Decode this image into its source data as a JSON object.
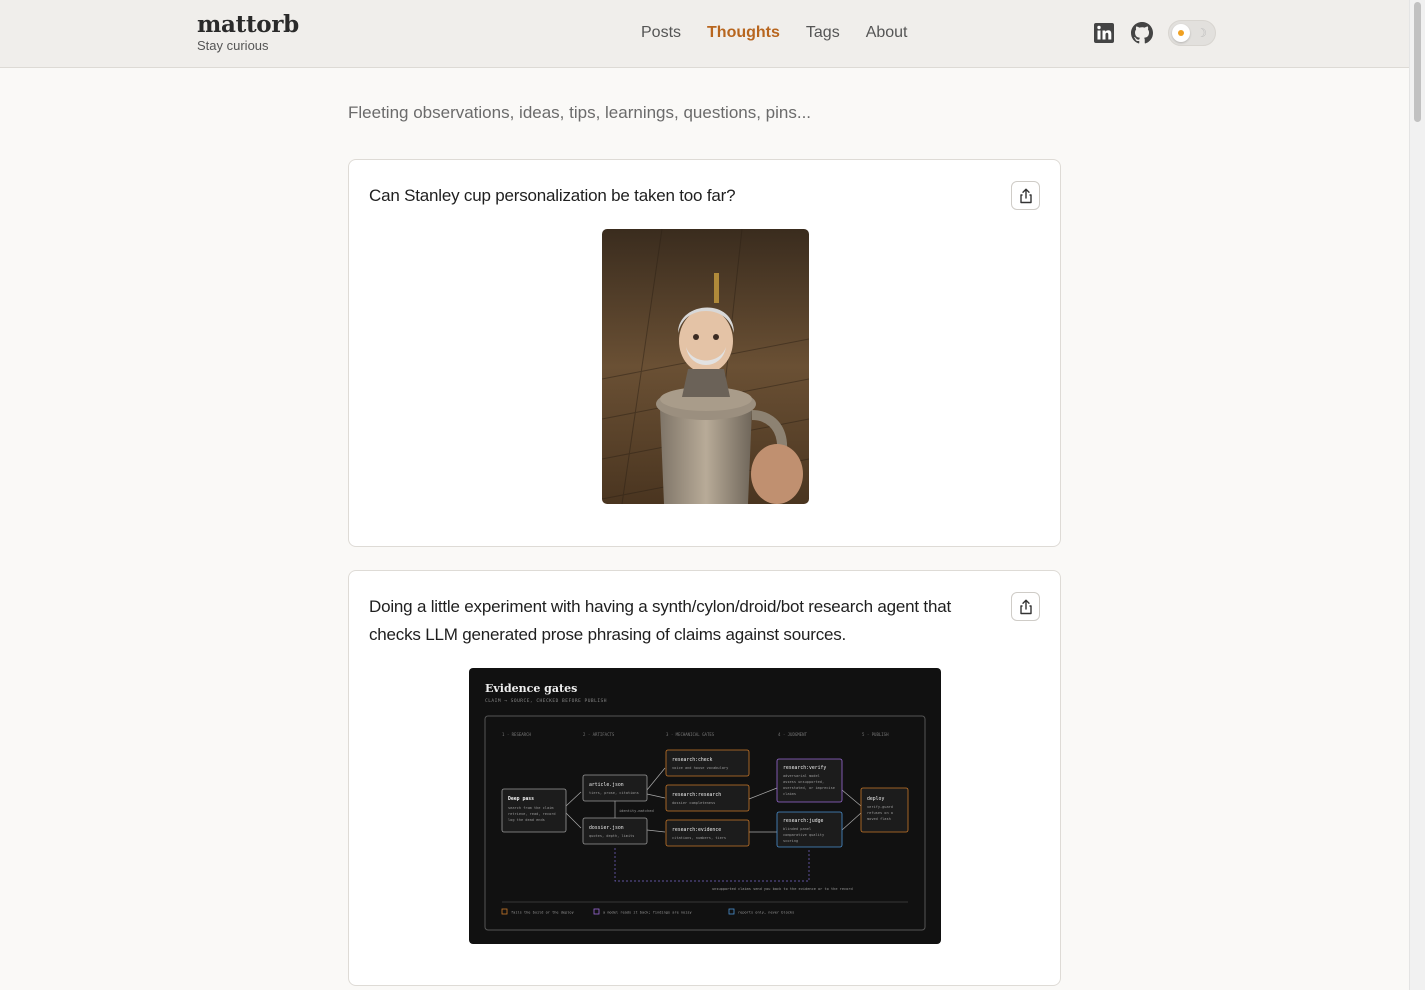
{
  "site": {
    "name": "mattorb",
    "tagline": "Stay curious"
  },
  "nav": [
    {
      "label": "Posts",
      "active": false
    },
    {
      "label": "Thoughts",
      "active": true
    },
    {
      "label": "Tags",
      "active": false
    },
    {
      "label": "About",
      "active": false
    }
  ],
  "header_icons": [
    "linkedin-icon",
    "github-icon",
    "theme-toggle"
  ],
  "accent_color": "#b8661f",
  "intro": "Fleeting observations, ideas, tips, learnings, questions, pins...",
  "posts": [
    {
      "text": "Can Stanley cup personalization be taken too far?",
      "media": "photo"
    },
    {
      "text": "Doing a little experiment with having a synth/cylon/droid/bot research agent that checks LLM generated prose phrasing of claims against sources.",
      "media": "diagram"
    }
  ],
  "diagram": {
    "title": "Evidence gates",
    "subtitle": "CLAIM → SOURCE, CHECKED BEFORE PUBLISH",
    "columns": [
      "1 · RESEARCH",
      "2 · ARTIFACTS",
      "3 · MECHANICAL GATES",
      "4 · JUDGMENT",
      "5 · PUBLISH"
    ],
    "nodes": {
      "deep": {
        "name": "Deep pass",
        "desc": [
          "search from the claim",
          "retrieve, read, record",
          "log the dead ends"
        ]
      },
      "article": {
        "name": "article.json",
        "desc": "tiers, prose, citations"
      },
      "dossier": {
        "name": "dossier.json",
        "desc": "quotes, depth, limits"
      },
      "check": {
        "name": "research:check",
        "desc": "voice and house vocabulary"
      },
      "research": {
        "name": "research:research",
        "desc": "dossier completeness"
      },
      "evidence": {
        "name": "research:evidence",
        "desc": "citations, numbers, tiers"
      },
      "verify": {
        "name": "research:verify",
        "desc": [
          "adversarial model",
          "assess unsupported,",
          "overstated, or imprecise",
          "claims"
        ]
      },
      "judge": {
        "name": "research:judge",
        "desc": [
          "blinded panel",
          "comparative quality",
          "scoring"
        ]
      },
      "deploy": {
        "name": "deploy",
        "desc": [
          "verify-guard",
          "refuses on a",
          "moved flash"
        ]
      }
    },
    "identity_label": "identity-matched",
    "loop_label": "unsupported claims send you back to the evidence or to the record",
    "legend": [
      {
        "color": "#c8782a",
        "text": "fails the build or the deploy"
      },
      {
        "color": "#9a6ad6",
        "text": "a model reads it back; findings are noisy"
      },
      {
        "color": "#4a90d0",
        "text": "reports only, never blocks"
      }
    ]
  }
}
